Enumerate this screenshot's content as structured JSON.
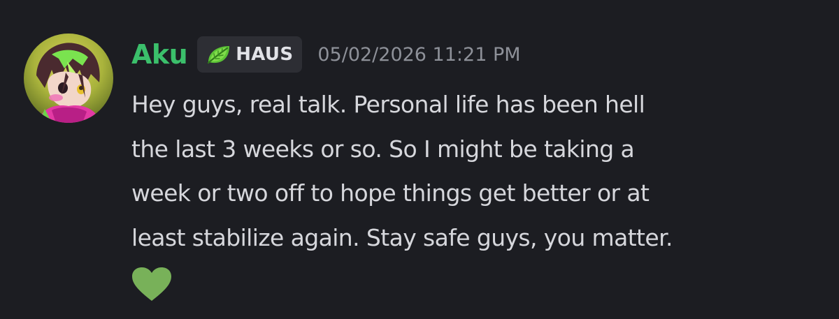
{
  "message": {
    "author": {
      "name": "Aku",
      "name_color": "#3bbf6b",
      "avatar": "anime-character-avatar"
    },
    "tag": {
      "icon": "leaf-icon",
      "label": "HAUS"
    },
    "timestamp": "05/02/2026 11:21 PM",
    "content_lines": [
      "Hey guys, real talk. Personal life has been hell",
      "the last 3 weeks or so. So I might be taking a",
      "week or two off to hope things get better or at",
      "least stabilize again. Stay safe guys, you matter."
    ],
    "emoji": "green-heart-emoji"
  },
  "colors": {
    "background": "#1c1d22",
    "text": "#d6d7dc",
    "timestamp": "#8e9199",
    "tag_background": "#2d2e34",
    "heart": "#78b159"
  }
}
